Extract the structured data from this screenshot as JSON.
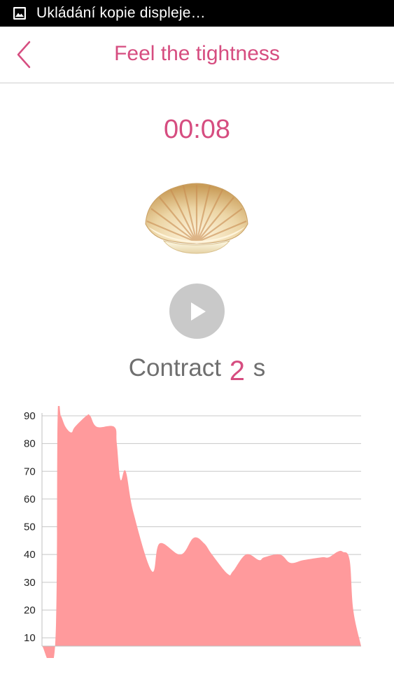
{
  "status_bar": {
    "notification_text": "Ukládání kopie displeje…",
    "icon": "image-icon"
  },
  "header": {
    "title": "Feel the tightness",
    "back_icon": "chevron-left-icon"
  },
  "timer": {
    "value": "00:08"
  },
  "illustration": {
    "icon": "seashell-icon"
  },
  "player": {
    "icon": "play-icon"
  },
  "instruction": {
    "label": "Contract",
    "value": "2",
    "unit": "s"
  },
  "colors": {
    "accent": "#d64d80",
    "area_fill": "#ff9a9c",
    "play_button": "#c9c9c9"
  },
  "chart_data": {
    "type": "area",
    "title": "",
    "xlabel": "",
    "ylabel": "",
    "ylim": [
      7,
      91
    ],
    "yticks": [
      90,
      80,
      70,
      60,
      50,
      40,
      30,
      20,
      10
    ],
    "grid": true,
    "series": [
      {
        "x": [
          0,
          2.5,
          3,
          3.6,
          4.5,
          5.6,
          6.3,
          8.5,
          9.2,
          10.5,
          13.8,
          14.3,
          15,
          16,
          17.5,
          21,
          22.5,
          26.5,
          29,
          31,
          32.5,
          35.5,
          36.5,
          39,
          41.5,
          42.5,
          45.5,
          47.5,
          50,
          53.5,
          54.8,
          56.5,
          57.5,
          58.8,
          59.5,
          61
        ],
        "y": [
          7,
          7,
          90,
          90,
          86,
          84,
          86,
          90,
          90,
          86,
          86,
          80,
          67,
          70,
          55,
          34,
          44,
          40,
          46,
          44,
          40,
          33,
          34,
          40,
          38,
          39,
          40,
          37,
          38,
          39,
          39,
          41,
          41,
          38,
          20,
          7
        ]
      }
    ]
  }
}
